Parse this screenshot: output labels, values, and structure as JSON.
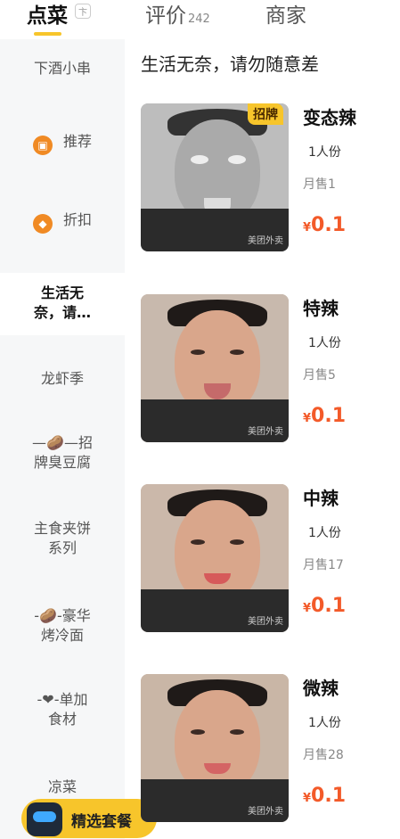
{
  "tabs": {
    "dishes": "点菜",
    "dishes_badge": "卞",
    "reviews": "评价",
    "reviews_count": "242",
    "merchant": "商家"
  },
  "sidebar": {
    "items": [
      {
        "label": "下酒小串"
      },
      {
        "label": "推荐",
        "icon": "recommend-icon"
      },
      {
        "label": "折扣",
        "icon": "discount-icon"
      },
      {
        "label_line1": "生活无",
        "label_line2": "奈，请…"
      },
      {
        "label": "龙虾季"
      },
      {
        "label_line1": "—🥔—招",
        "label_line2": "牌臭豆腐"
      },
      {
        "label_line1": "主食夹饼",
        "label_line2": "系列"
      },
      {
        "label_line1": "-🥔-豪华",
        "label_line2": "烤冷面"
      },
      {
        "label_line1": "-❤-单加",
        "label_line2": "食材"
      },
      {
        "label": "凉菜"
      }
    ]
  },
  "combo_button": "精选套餐",
  "main": {
    "section_title": "生活无奈，请勿随意差",
    "dishes": [
      {
        "name": "变态辣",
        "portion": "1人份",
        "sales": "月售1",
        "currency": "¥",
        "price": "0.1",
        "badge": "招牌",
        "watermark": "美团外卖"
      },
      {
        "name": "特辣",
        "portion": "1人份",
        "sales": "月售5",
        "currency": "¥",
        "price": "0.1",
        "watermark": "美团外卖"
      },
      {
        "name": "中辣",
        "portion": "1人份",
        "sales": "月售17",
        "currency": "¥",
        "price": "0.1",
        "watermark": "美团外卖"
      },
      {
        "name": "微辣",
        "portion": "1人份",
        "sales": "月售28",
        "currency": "¥",
        "price": "0.1",
        "watermark": "美团外卖"
      }
    ]
  },
  "colors": {
    "accent": "#f7c52b",
    "price": "#f35a29",
    "sidebar_bg": "#f6f7f8"
  }
}
